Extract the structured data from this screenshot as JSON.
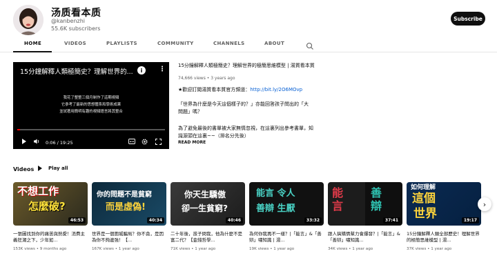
{
  "channel": {
    "name": "汤质看本质",
    "handle": "@kanbenzhi",
    "subscribers": "55.6K subscribers",
    "subscribe_label": "Subscribe"
  },
  "tabs": [
    {
      "label": "HOME",
      "active": true
    },
    {
      "label": "VIDEOS"
    },
    {
      "label": "PLAYLISTS"
    },
    {
      "label": "COMMUNITY"
    },
    {
      "label": "CHANNELS"
    },
    {
      "label": "ABOUT"
    }
  ],
  "featured": {
    "player_title": "15分鐘解釋人類極簡史？理解世界的...",
    "subtitle_lines": [
      "我花了整整三個月制作了這期視頻",
      "它參考了最新的思想體系和學術成果",
      "並試著用簡明有趣的視頻語言將其整合"
    ],
    "time": "0:06 / 19:25",
    "title": "15分鐘解釋人類極簡史？理解世界的極簡思維模型 | 湯質看本質",
    "meta": "74,666 views • 3 years ago",
    "desc_line1_prefix": "★歡迎訂閱湯質看本質官方頻道：",
    "desc_link": "http://bit.ly/2O6MOvp",
    "desc_line2": "「世界為什麼是今天這個樣子的？」亦能回答孩子問出的「大",
    "desc_line3": "問題」嗎？",
    "desc_line4": "為了避免最後的書單被大家無情忽視，在這裏列出參考書單，知",
    "desc_line5": "識源頭在這裏~~（排名分先後）",
    "read_more": "READ MORE"
  },
  "shelf": {
    "title": "Videos",
    "play_all": "Play all"
  },
  "videos": [
    {
      "thumb_text": [
        "不想工作",
        "怎麼破?"
      ],
      "duration": "46:53",
      "title": "一張圖找到你的痛苦與熱愛！消費主義狂潮之下，少年如...",
      "meta": "153K views • 9 months ago"
    },
    {
      "thumb_text": [
        "你的問題不是貧窮",
        "而是虛偽!"
      ],
      "duration": "40:34",
      "title": "世界是一個圍城騙局？你不貪，是因為你不夠邊強！【...",
      "meta": "167K views • 1 year ago"
    },
    {
      "thumb_text": [
        "你天生驕傲",
        "卻一生貧窮?"
      ],
      "duration": "40:46",
      "title": "二十年後，孩子問我，他為什麼不是富二代？【金錢哲學...",
      "meta": "71K views • 1 year ago"
    },
    {
      "thumb_text": [
        "能言 令人",
        "善辯 生厭"
      ],
      "duration": "33:32",
      "title": "為何你我再不一樣？|「能言」&「善辯」嘯知識 | 湯...",
      "meta": "19K views • 1 year ago"
    },
    {
      "thumb_text": [
        "能言",
        "善辯"
      ],
      "duration": "37:41",
      "title": "跟人搞矯情幫力會爆發？|「能言」&「善辯」嘯知識...",
      "meta": "34K views • 1 year ago"
    },
    {
      "thumb_text": [
        "如何理解",
        "這個",
        "世界"
      ],
      "duration": "19:17",
      "title": "15分鐘解釋人類全部歷史！理解世界的極簡思維模型 | 湯...",
      "meta": "37K views • 1 year ago"
    }
  ],
  "colors": {
    "subscribe_bg": "#0f0f0f",
    "link": "#065fd4",
    "progress": "#ff0000"
  }
}
